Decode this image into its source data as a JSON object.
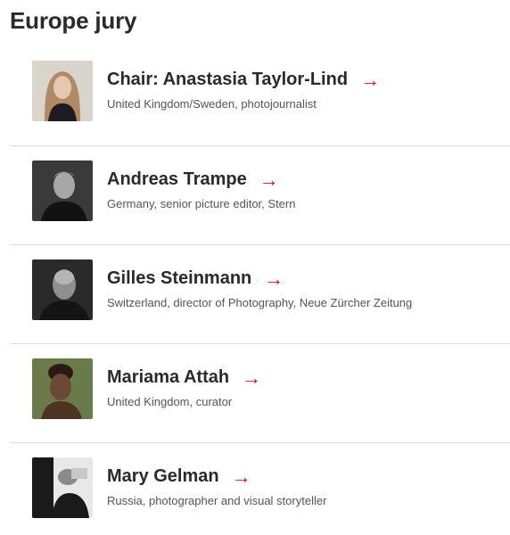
{
  "page": {
    "title": "Europe jury"
  },
  "jury": [
    {
      "name": "Chair: Anastasia Taylor-Lind",
      "description": "United Kingdom/Sweden, photojournalist",
      "avatar_colors": [
        "#d9d5cc",
        "#b08a64",
        "#1e1c22",
        "#e6c8ae"
      ]
    },
    {
      "name": "Andreas Trampe",
      "description": "Germany, senior picture editor, Stern",
      "avatar_colors": [
        "#3a3a3a",
        "#a7a7a7",
        "#121212",
        "#cfcfcf"
      ]
    },
    {
      "name": "Gilles Steinmann",
      "description": "Switzerland, director of Photography, Neue Zürcher Zeitung",
      "avatar_colors": [
        "#2a2a2a",
        "#8f8f8f",
        "#141414",
        "#b5b5b5"
      ]
    },
    {
      "name": "Mariama Attah",
      "description": "United Kingdom, curator",
      "avatar_colors": [
        "#6b7a4a",
        "#2b1a14",
        "#4d3322",
        "#6a4a35"
      ]
    },
    {
      "name": "Mary Gelman",
      "description": "Russia, photographer and visual storyteller",
      "avatar_colors": [
        "#e8e8e8",
        "#1a1a1a",
        "#8a8a8a",
        "#c8c8c8"
      ]
    }
  ],
  "arrow_glyph": "→",
  "colors": {
    "accent": "#d20a3c",
    "divider": "#dcdcdc"
  }
}
